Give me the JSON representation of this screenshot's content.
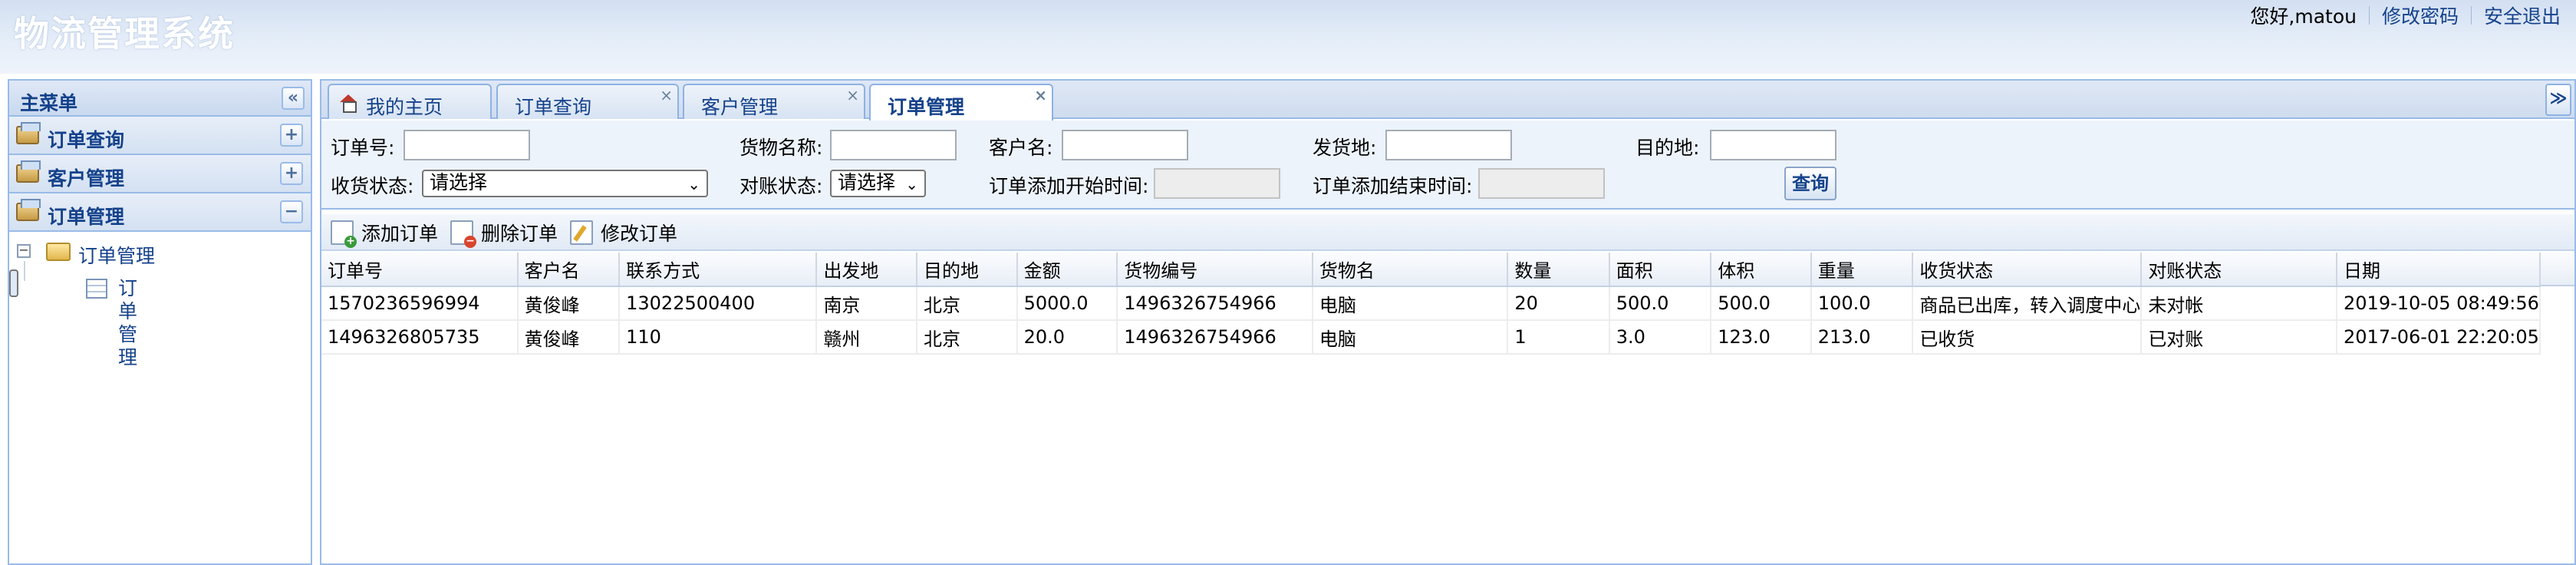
{
  "header": {
    "title": "物流管理系统",
    "greeting": "您好,matou",
    "change_password": "修改密码",
    "logout": "安全退出"
  },
  "west": {
    "title": "主菜单",
    "collapse_glyph": "«",
    "sections": [
      {
        "label": "订单查询",
        "state": "+"
      },
      {
        "label": "客户管理",
        "state": "+"
      },
      {
        "label": "订单管理",
        "state": "−"
      }
    ],
    "tree": {
      "folder_label": "订单管理",
      "expander": "−",
      "leaf_label": "订单管理"
    }
  },
  "tabs": [
    {
      "label": "我的主页",
      "closable": false,
      "icon": "home-icon"
    },
    {
      "label": "订单查询",
      "closable": true
    },
    {
      "label": "客户管理",
      "closable": true
    },
    {
      "label": "订单管理",
      "closable": true,
      "active": true
    }
  ],
  "tab_close_glyph": "×",
  "tab_menu_glyph": "≫",
  "search": {
    "order_no_label": "订单号:",
    "goods_name_label": "货物名称:",
    "customer_name_label": "客户名:",
    "origin_label": "发货地:",
    "destination_label": "目的地:",
    "receive_status_label": "收货状态:",
    "receive_status_value": "请选择",
    "reconcile_status_label": "对账状态:",
    "reconcile_status_value": "请选择",
    "start_time_label": "订单添加开始时间:",
    "end_time_label": "订单添加结束时间:",
    "query_button": "查询"
  },
  "toolbar": {
    "add": "添加订单",
    "delete": "删除订单",
    "edit": "修改订单"
  },
  "grid": {
    "columns": [
      "订单号",
      "客户名",
      "联系方式",
      "出发地",
      "目的地",
      "金额",
      "货物编号",
      "货物名",
      "数量",
      "面积",
      "体积",
      "重量",
      "收货状态",
      "对账状态",
      "日期"
    ],
    "rows": [
      [
        "1570236596994",
        "黄俊峰",
        "13022500400",
        "南京",
        "北京",
        "5000.0",
        "1496326754966",
        "电脑",
        "20",
        "500.0",
        "500.0",
        "100.0",
        "商品已出库，转入调度中心",
        "未对帐",
        "2019-10-05 08:49:56"
      ],
      [
        "1496326805735",
        "黄俊峰",
        "110",
        "赣州",
        "北京",
        "20.0",
        "1496326754966",
        "电脑",
        "1",
        "3.0",
        "123.0",
        "213.0",
        "已收货",
        "已对账",
        "2017-06-01 22:20:05"
      ]
    ]
  },
  "colors": {
    "header_bg": "#d3e0f2",
    "border": "#99bbe8",
    "title_text": "#15428b"
  }
}
